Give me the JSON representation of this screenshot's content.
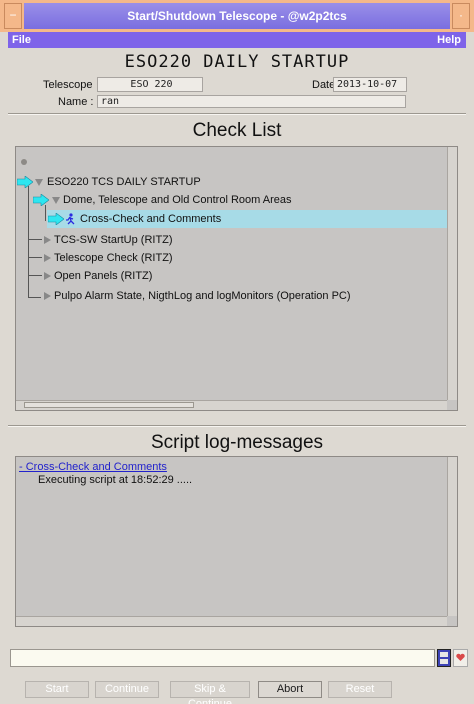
{
  "window": {
    "title": "Start/Shutdown Telescope - @w2p2tcs"
  },
  "menu": {
    "file": "File",
    "help": "Help"
  },
  "header": {
    "title": "ESO220 DAILY STARTUP",
    "telescope_label": "Telescope",
    "telescope_value": "ESO 220",
    "date_label": "Date",
    "date_value": "2013-10-07",
    "name_label": "Name :",
    "name_value": "ran"
  },
  "checklist": {
    "title": "Check List",
    "items": [
      {
        "label": "ESO220 TCS DAILY STARTUP",
        "level": 0,
        "state": "running"
      },
      {
        "label": "Dome, Telescope and Old Control Room Areas",
        "level": 1,
        "state": "running"
      },
      {
        "label": "Cross-Check and Comments",
        "level": 2,
        "state": "executing"
      },
      {
        "label": "TCS-SW StartUp (RITZ)",
        "level": 1,
        "state": "pending"
      },
      {
        "label": "Telescope Check (RITZ)",
        "level": 1,
        "state": "pending"
      },
      {
        "label": "Open Panels (RITZ)",
        "level": 1,
        "state": "pending"
      },
      {
        "label": "Pulpo Alarm State,  NigthLog and logMonitors (Operation PC)",
        "level": 1,
        "state": "pending"
      }
    ]
  },
  "log": {
    "title": "Script log-messages",
    "link": "- Cross-Check and Comments",
    "message": "Executing script at 18:52:29 ....."
  },
  "command_input": {
    "value": ""
  },
  "buttons": {
    "start": "Start",
    "continue": "Continue",
    "skip": "Skip & Continue",
    "abort": "Abort",
    "reset": "Reset"
  },
  "colors": {
    "titlebar": "#f4b88a",
    "menubar": "#7e63e9",
    "selection": "#a7dbe7",
    "arrow": "#2ee6f0"
  }
}
